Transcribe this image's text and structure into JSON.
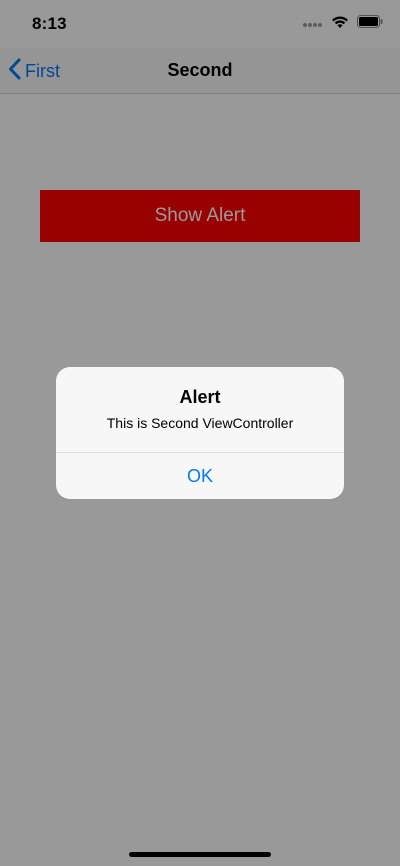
{
  "status_bar": {
    "time": "8:13",
    "icons": [
      "signal-dots-icon",
      "wifi-icon",
      "battery-icon"
    ]
  },
  "nav_bar": {
    "back_label": "First",
    "title": "Second"
  },
  "main": {
    "button_label": "Show Alert",
    "button_color": "#ff0000"
  },
  "alert": {
    "title": "Alert",
    "message": "This is Second ViewController",
    "ok_label": "OK"
  },
  "colors": {
    "accent": "#007aff",
    "overlay": "rgba(0,0,0,0.4)"
  }
}
